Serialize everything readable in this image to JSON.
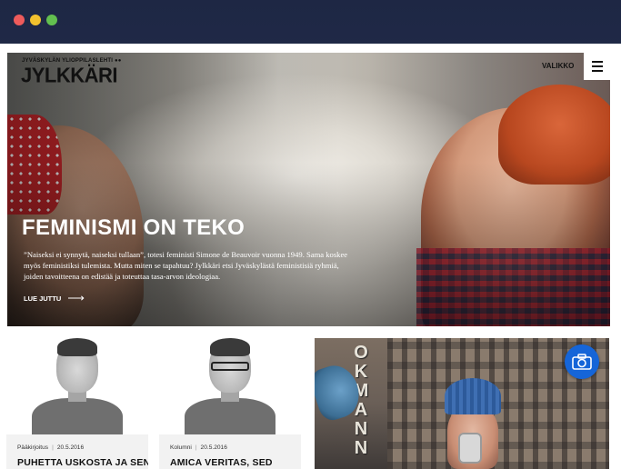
{
  "window_controls": {
    "close": "red-dot",
    "minimize": "yellow-dot",
    "maximize": "green-dot"
  },
  "header": {
    "logo_tagline": "JYVÄSKYLÄN YLIOPPILASLEHTI ●●",
    "logo_text": "JYLKKÄRI",
    "menu_label": "VALIKKO",
    "menu_icon": "hamburger-icon"
  },
  "hero": {
    "title": "FEMINISMI ON TEKO",
    "lead": "”Naiseksi ei synnytä, naiseksi tullaan”, totesi feministi Simone de Beauvoir vuonna 1949. Sama koskee myös feministiksi tulemista. Mutta miten se tapahtuu? Jylkkäri etsi Jyväskylästä feministisiä ryhmiä, joiden tavoitteena on edistää ja toteuttaa tasa-arvon ideologiaa.",
    "read_more": "LUE JUTTU",
    "read_more_icon": "arrow-right-icon"
  },
  "cards": [
    {
      "category": "Pääkirjoitus",
      "date": "20.5.2016",
      "headline": "PUHETTA USKOSTA JA SEN"
    },
    {
      "category": "Kolumni",
      "date": "20.5.2016",
      "headline": "AMICA VERITAS, SED"
    }
  ],
  "photo_card": {
    "sign_text": "OKMANN",
    "gallery_icon": "camera-icon"
  },
  "colors": {
    "accent": "#1565d8",
    "frame_bg": "#1e2744",
    "text_dark": "#111111"
  }
}
